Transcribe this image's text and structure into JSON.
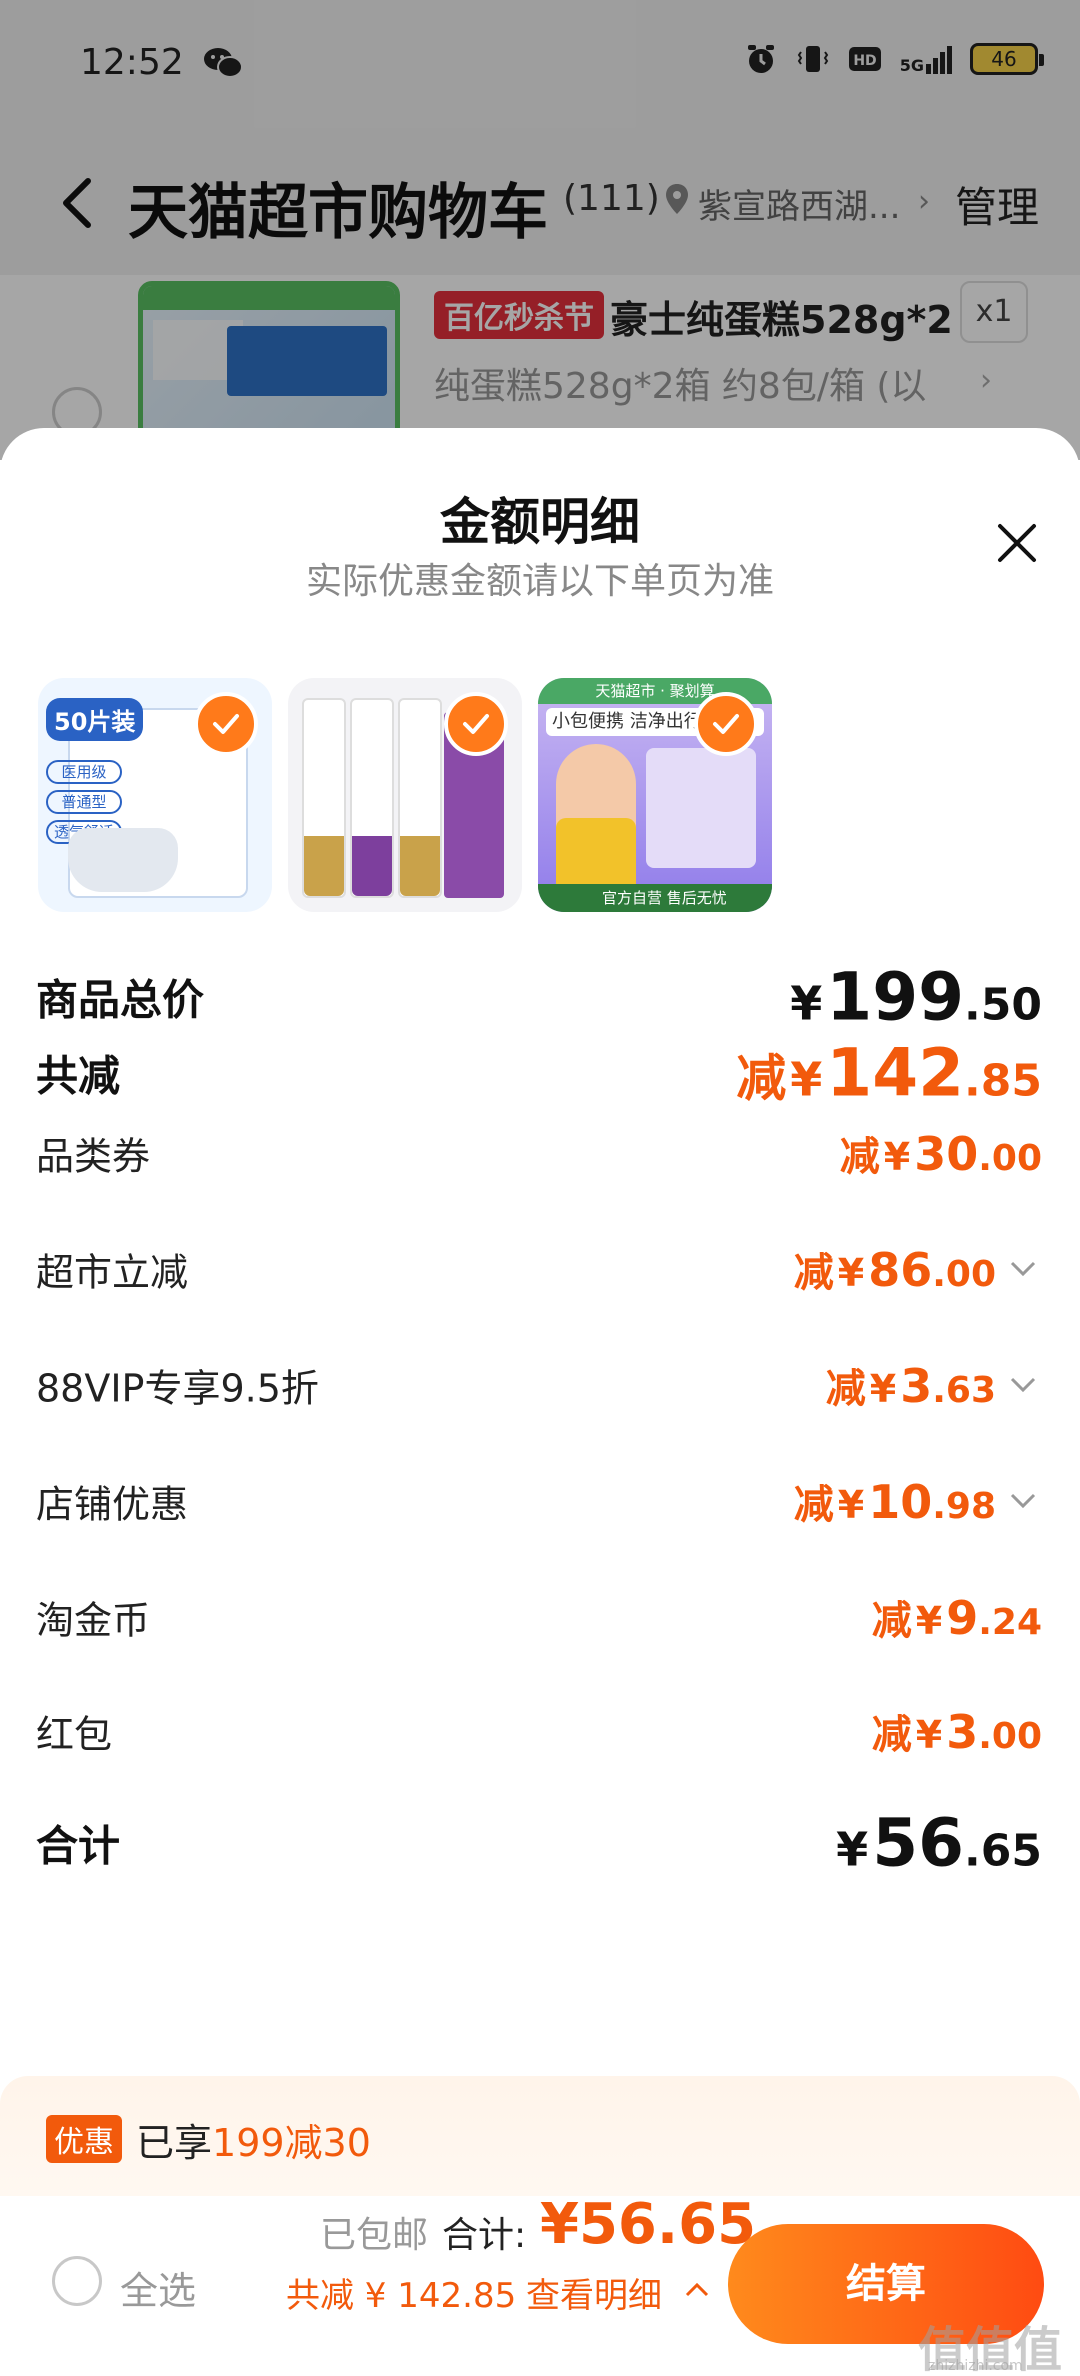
{
  "status_bar": {
    "time": "12:52",
    "network": "5G",
    "battery": "46",
    "icons": [
      "wechat-icon",
      "alarm-icon",
      "vibrate-icon",
      "hd-icon",
      "signal-icon",
      "battery-icon"
    ]
  },
  "header": {
    "title": "天猫超市购物车",
    "count": "(111)",
    "location": "紫宣路西湖...",
    "chevron": "›",
    "manage": "管理"
  },
  "background_item": {
    "promo_tag": "百亿秒杀节",
    "title": "豪士纯蛋糕528g*2",
    "quantity": "x1",
    "sku": "纯蛋糕528g*2箱 约8包/箱 (以",
    "chevron": "›"
  },
  "sheet": {
    "title": "金额明细",
    "subtitle": "实际优惠金额请以下单页为准",
    "products": [
      {
        "name": "口罩",
        "badge": "50片装",
        "pills": [
          "医用级",
          "普通型",
          "透气舒适"
        ]
      },
      {
        "name": "牙膏"
      },
      {
        "name": "湿巾",
        "top_label": "天猫超市 · 聚划算",
        "banner": "小包便携 洁净出行",
        "footer": "官方自营 售后无忧"
      }
    ],
    "rows": [
      {
        "label": "商品总价",
        "prefix": "",
        "currency": "¥",
        "int": "199",
        "dec": ".50"
      },
      {
        "label": "共减",
        "prefix": "减",
        "currency": "¥",
        "int": "142",
        "dec": ".85"
      },
      {
        "label": "品类券",
        "prefix": "减",
        "currency": "¥",
        "int": "30",
        "dec": ".00"
      },
      {
        "label": "超市立减",
        "prefix": "减",
        "currency": "¥",
        "int": "86",
        "dec": ".00"
      },
      {
        "label": "88VIP专享9.5折",
        "prefix": "减",
        "currency": "¥",
        "int": "3",
        "dec": ".63"
      },
      {
        "label": "店铺优惠",
        "prefix": "减",
        "currency": "¥",
        "int": "10",
        "dec": ".98"
      },
      {
        "label": "淘金币",
        "prefix": "减",
        "currency": "¥",
        "int": "9",
        "dec": ".24"
      },
      {
        "label": "红包",
        "prefix": "减",
        "currency": "¥",
        "int": "3",
        "dec": ".00"
      },
      {
        "label": "合计",
        "prefix": "",
        "currency": "¥",
        "int": "56",
        "dec": ".65"
      }
    ]
  },
  "promo": {
    "tag": "优惠",
    "text": "已享",
    "highlight": "199减30"
  },
  "bottom_bar": {
    "select_all": "全选",
    "shipping": "已包邮",
    "total_label": "合计:",
    "total_amount": "¥56.65",
    "saved": "共减 ¥ 142.85",
    "detail_link": "查看明细",
    "checkout": "结算"
  },
  "watermark": {
    "text": "值值值",
    "url": "zhizhizhi.com"
  },
  "colors": {
    "accent": "#f25a0c",
    "checkout_start": "#ff8a1c",
    "checkout_end": "#ff4b12",
    "promo_tag_red": "#e5313d"
  }
}
